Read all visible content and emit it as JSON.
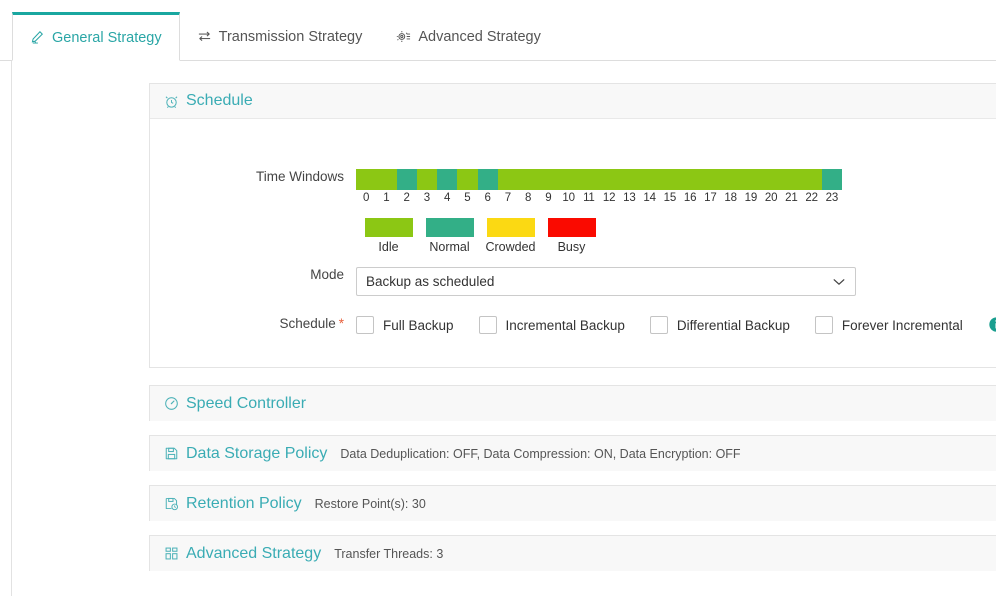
{
  "tabs": [
    {
      "label": "General Strategy",
      "icon": "pencil-ruler-icon",
      "active": true
    },
    {
      "label": "Transmission Strategy",
      "icon": "transfer-arrows-icon",
      "active": false
    },
    {
      "label": "Advanced Strategy",
      "icon": "gear-list-icon",
      "active": false
    }
  ],
  "schedule_panel": {
    "title": "Schedule",
    "icon": "alarm-clock-icon",
    "time_windows": {
      "label": "Time Windows",
      "hours": [
        "0",
        "1",
        "2",
        "3",
        "4",
        "5",
        "6",
        "7",
        "8",
        "9",
        "10",
        "11",
        "12",
        "13",
        "14",
        "15",
        "16",
        "17",
        "18",
        "19",
        "20",
        "21",
        "22",
        "23"
      ],
      "states": [
        "Idle",
        "Idle",
        "Normal",
        "Idle",
        "Normal",
        "Idle",
        "Normal",
        "Idle",
        "Idle",
        "Idle",
        "Idle",
        "Idle",
        "Idle",
        "Idle",
        "Idle",
        "Idle",
        "Idle",
        "Idle",
        "Idle",
        "Idle",
        "Idle",
        "Idle",
        "Idle",
        "Normal"
      ],
      "legend": [
        {
          "label": "Idle",
          "color": "#8cc714"
        },
        {
          "label": "Normal",
          "color": "#33af87"
        },
        {
          "label": "Crowded",
          "color": "#fbd913"
        },
        {
          "label": "Busy",
          "color": "#fa0a00"
        }
      ],
      "colors": {
        "Idle": "#8cc714",
        "Normal": "#33af87",
        "Crowded": "#fbd913",
        "Busy": "#fa0a00"
      }
    },
    "mode": {
      "label": "Mode",
      "value": "Backup as scheduled",
      "caret": "chevron-down-icon"
    },
    "schedule": {
      "label": "Schedule",
      "required_marker": "*",
      "options": [
        {
          "label": "Full Backup",
          "checked": false
        },
        {
          "label": "Incremental Backup",
          "checked": false
        },
        {
          "label": "Differential Backup",
          "checked": false
        },
        {
          "label": "Forever Incremental",
          "checked": false
        }
      ],
      "info_icon": "info-circle-icon"
    }
  },
  "sections": [
    {
      "title": "Speed Controller",
      "icon": "gauge-icon",
      "summary": ""
    },
    {
      "title": "Data Storage Policy",
      "icon": "save-disk-icon",
      "summary": "Data Deduplication: OFF, Data Compression: ON, Data Encryption: OFF"
    },
    {
      "title": "Retention Policy",
      "icon": "archive-clock-icon",
      "summary": "Restore Point(s): 30"
    },
    {
      "title": "Advanced Strategy",
      "icon": "grid-blocks-icon",
      "summary": "Transfer Threads: 3"
    }
  ],
  "theme": {
    "accent": "#3aacb4",
    "active_tab": "#19a7a0",
    "required": "#e8603c"
  }
}
